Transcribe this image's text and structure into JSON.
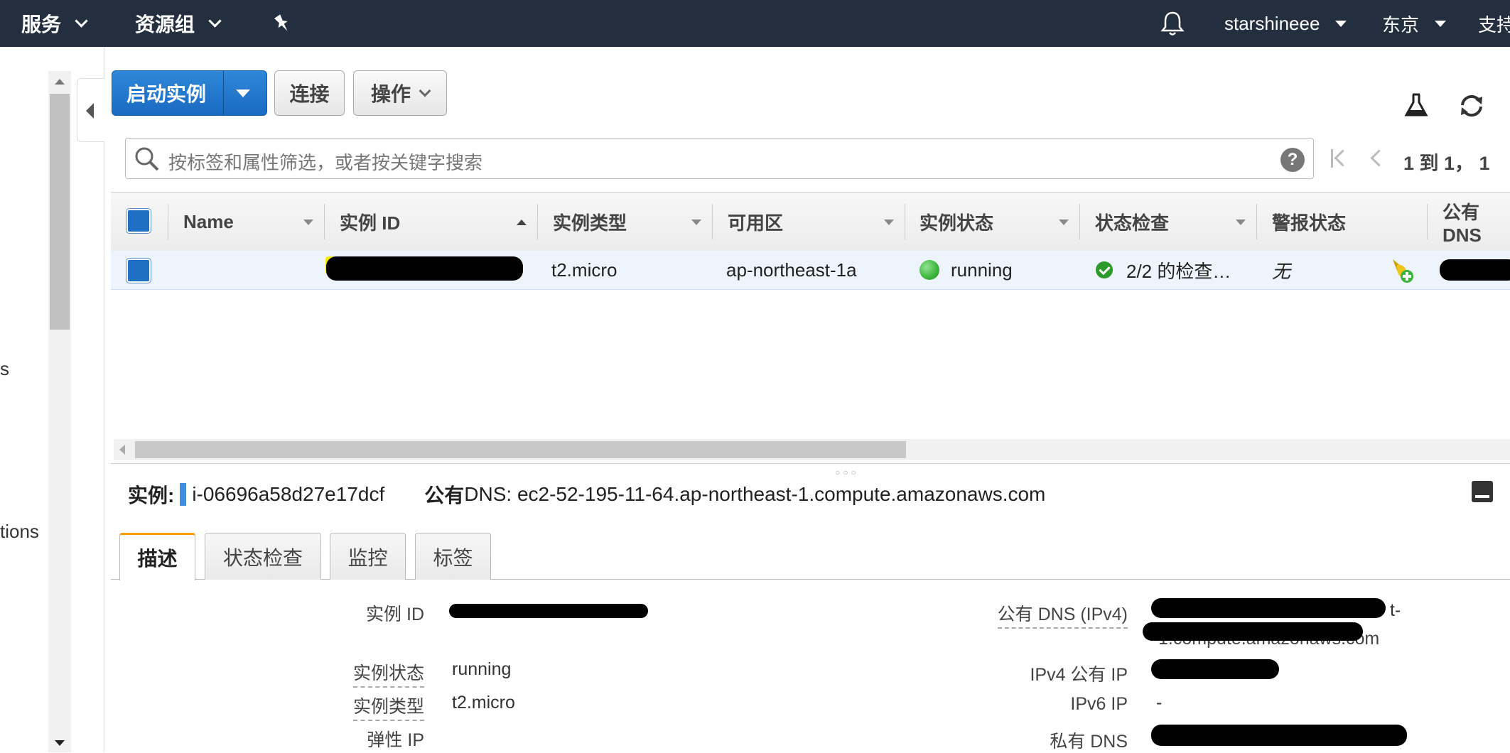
{
  "nav": {
    "services": "服务",
    "resource_groups": "资源组",
    "user": "starshineee",
    "region": "东京",
    "support": "支持"
  },
  "sidebar": {
    "fragment_1": "s",
    "fragment_2": "tions"
  },
  "toolbar": {
    "launch": "启动实例",
    "connect": "连接",
    "actions": "操作"
  },
  "search": {
    "placeholder": "按标签和属性筛选，或者按关键字搜索"
  },
  "pagination": {
    "text": "1 到 1， 1"
  },
  "table": {
    "columns": [
      "Name",
      "实例 ID",
      "实例类型",
      "可用区",
      "实例状态",
      "状态检查",
      "警报状态",
      "公有 DNS"
    ],
    "rows": [
      {
        "name": "",
        "instance_id": "[redacted]",
        "instance_type": "t2.micro",
        "az": "ap-northeast-1a",
        "state": "running",
        "status_check": "2/2 的检查…",
        "alarm": "无",
        "public_dns": "[redacted]"
      }
    ]
  },
  "details": {
    "instance_label": "实例:",
    "instance_id": "i-06696a58d27e17dcf",
    "dns_label_bold": "公有",
    "dns_label": " DNS: ec2-52-195-11-64.ap-northeast-1.compute.amazonaws.com",
    "tabs": [
      "描述",
      "状态检查",
      "监控",
      "标签"
    ],
    "fields_left": [
      {
        "label": "实例 ID",
        "value": ""
      },
      {
        "label": "实例状态",
        "value": "running"
      },
      {
        "label": "实例类型",
        "value": "t2.micro"
      },
      {
        "label": "弹性 IP",
        "value": ""
      }
    ],
    "fields_right": [
      {
        "label": "公有 DNS (IPv4)",
        "value": "t-"
      },
      {
        "label": "IPv4 公有 IP",
        "value": ""
      },
      {
        "label": "IPv6 IP",
        "value": "-"
      },
      {
        "label": "私有 DNS",
        "value": ""
      }
    ],
    "dns_value_line2": "1.compute.amazonaws.com"
  },
  "colors": {
    "nav_bg": "#232f3e",
    "primary": "#1a6ac2",
    "running": "#3cb43c",
    "active_tab": "#ff9900"
  }
}
